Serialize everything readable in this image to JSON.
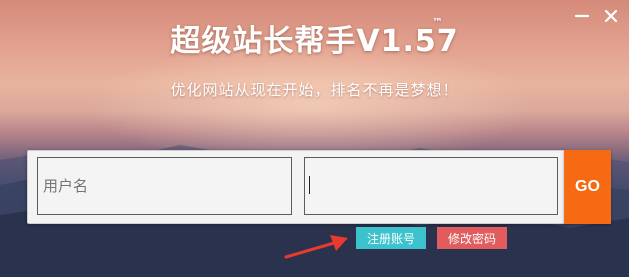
{
  "window": {
    "title": "超级站长帮手V1.57",
    "trademark": "™",
    "subtitle": "优化网站从现在开始，排名不再是梦想！"
  },
  "login": {
    "username_placeholder": "用户名",
    "username_value": "",
    "password_value": "",
    "go_label": "GO"
  },
  "actions": {
    "register_label": "注册账号",
    "change_password_label": "修改密码"
  },
  "colors": {
    "go_button": "#f56a12",
    "register_button": "#3bc2cc",
    "change_password_button": "#e15c5c",
    "arrow": "#e83a2e"
  },
  "icons": {
    "minimize": "minimize-icon",
    "close": "close-icon",
    "pointer_arrow": "arrow-icon"
  }
}
